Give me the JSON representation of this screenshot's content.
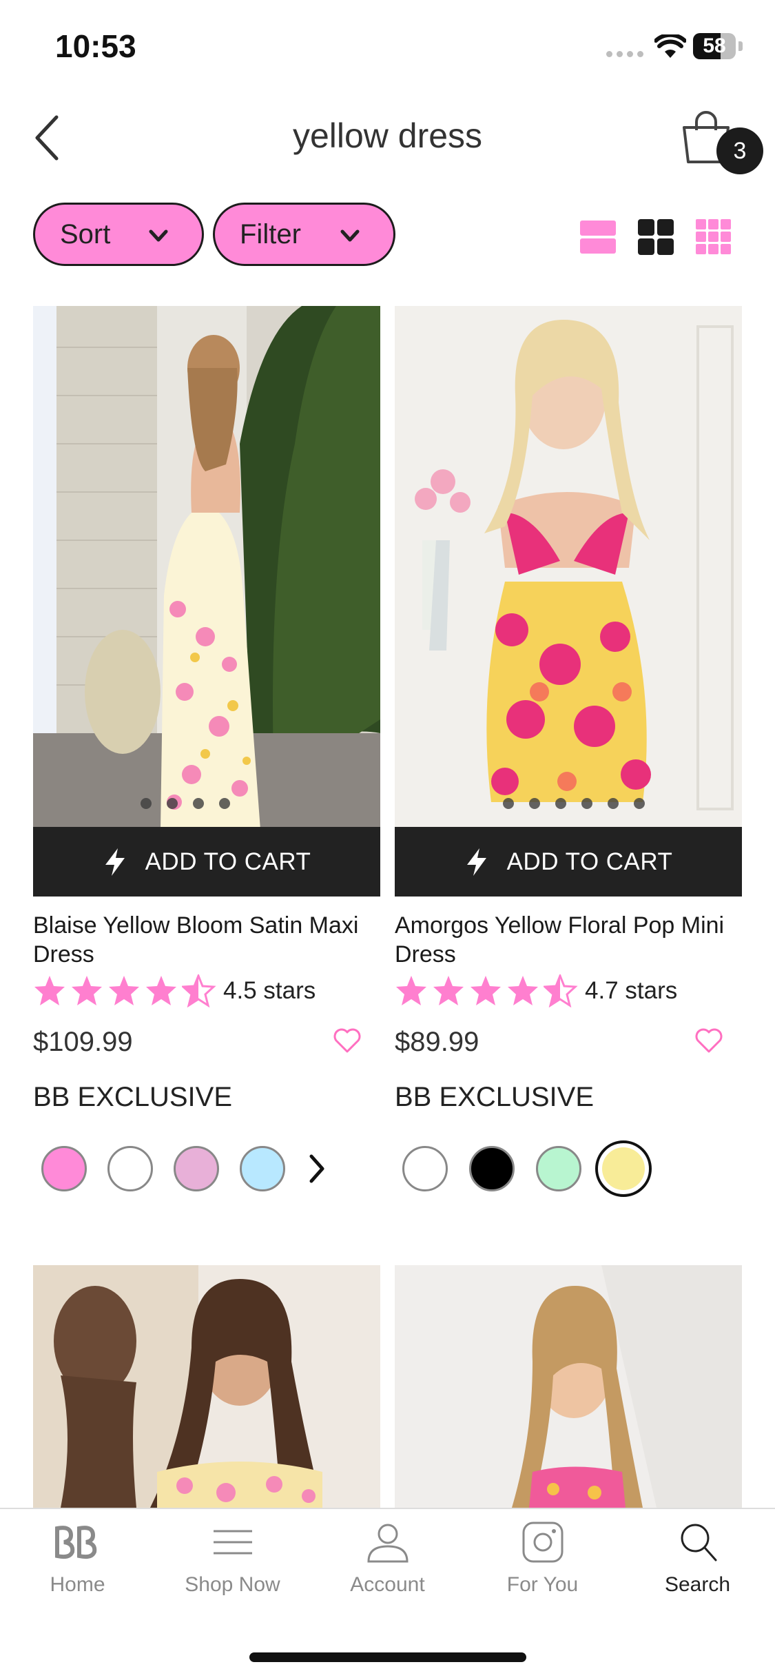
{
  "status_bar": {
    "time": "10:53",
    "battery": "58"
  },
  "header": {
    "title": "yellow dress",
    "cart_count": "3"
  },
  "toolbar": {
    "sort_label": "Sort",
    "filter_label": "Filter"
  },
  "products": [
    {
      "name": "Blaise Yellow Bloom Satin Maxi Dress",
      "rating_text": "4.5 stars",
      "rating": 4.5,
      "price": "$109.99",
      "badge": "BB EXCLUSIVE",
      "cta": "ADD TO CART",
      "swatches": [
        "#ff8ad8",
        "#ffffff",
        "#e8b0d8",
        "#b8e8ff"
      ]
    },
    {
      "name": "Amorgos Yellow Floral Pop Mini Dress",
      "rating_text": "4.7 stars",
      "rating": 4.7,
      "price": "$89.99",
      "badge": "BB EXCLUSIVE",
      "cta": "ADD TO CART",
      "swatches": [
        "#ffffff",
        "#000000",
        "#b8f5d0",
        "#f8ec98"
      ]
    }
  ],
  "tabs": [
    {
      "label": "Home",
      "icon": "brand-logo-icon"
    },
    {
      "label": "Shop Now",
      "icon": "menu-icon"
    },
    {
      "label": "Account",
      "icon": "user-icon"
    },
    {
      "label": "For You",
      "icon": "instagram-icon"
    },
    {
      "label": "Search",
      "icon": "search-icon"
    }
  ],
  "colors": {
    "accent": "#ff8ad8",
    "dark": "#222222"
  }
}
